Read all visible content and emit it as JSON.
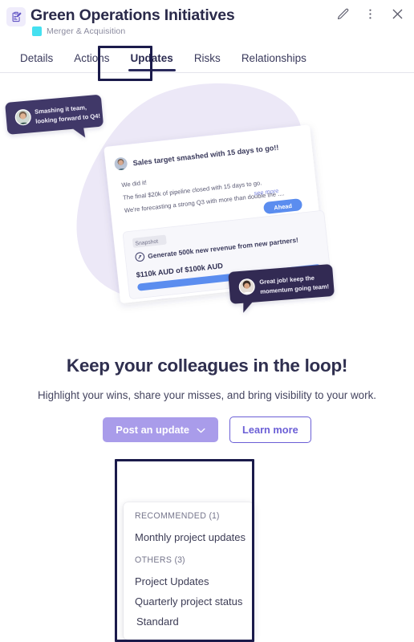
{
  "header": {
    "icon": "clipboard-pencil-icon",
    "title": "Green Operations Initiatives",
    "tag": {
      "label": "Merger & Acquisition",
      "color": "#45e0f0"
    },
    "actions": [
      {
        "name": "edit-icon",
        "label": "Edit"
      },
      {
        "name": "more-options-icon",
        "label": "More options"
      },
      {
        "name": "close-icon",
        "label": "Close"
      }
    ]
  },
  "tabs": [
    {
      "label": "Details",
      "active": false
    },
    {
      "label": "Actions",
      "active": false
    },
    {
      "label": "Updates",
      "active": true
    },
    {
      "label": "Risks",
      "active": false
    },
    {
      "label": "Relationships",
      "active": false
    }
  ],
  "illustration": {
    "bubble_top": {
      "text_line1": "Smashing it team,",
      "text_line2": "looking forward to Q4!",
      "avatar": "person-avatar"
    },
    "bubble_bottom": {
      "text_line1": "Great job! keep the",
      "text_line2": "momentum going team!",
      "avatar": "person-avatar"
    },
    "card": {
      "author_avatar": "person-avatar",
      "title": "Sales target smashed with 15 days to go!!",
      "body_line1": "We did it!",
      "body_line2": "The final $20k of pipeline closed with 15 days to go.",
      "body_line3": "We're forecasting a strong Q3 with more than double the ....",
      "see_more": "see more",
      "badge": "Ahead",
      "snapshot": {
        "label": "Snapshot",
        "goal": "Generate 500k new revenue from new partners!",
        "progress_text": "$110k AUD of $100k AUD",
        "progress_percent": 100
      }
    },
    "colors": {
      "blob": "#ece8f7",
      "bubble": "#403868",
      "badge": "#5b8def",
      "progress": "#5b8def"
    }
  },
  "empty_state": {
    "headline": "Keep your colleagues in the loop!",
    "subhead": "Highlight your wins, share your misses, and bring visibility to your work.",
    "primary_button": "Post an update",
    "secondary_button": "Learn more"
  },
  "dropdown": {
    "groups": [
      {
        "label": "RECOMMENDED",
        "count": "(1)",
        "items": [
          {
            "label": "Monthly project updates"
          }
        ]
      },
      {
        "label": "OTHERS",
        "count": "(3)",
        "items": [
          {
            "label": "Project Updates"
          },
          {
            "label": "Quarterly project status"
          },
          {
            "label": "Standard"
          }
        ]
      }
    ]
  },
  "highlights": {
    "accent": "#1b1b4b"
  }
}
